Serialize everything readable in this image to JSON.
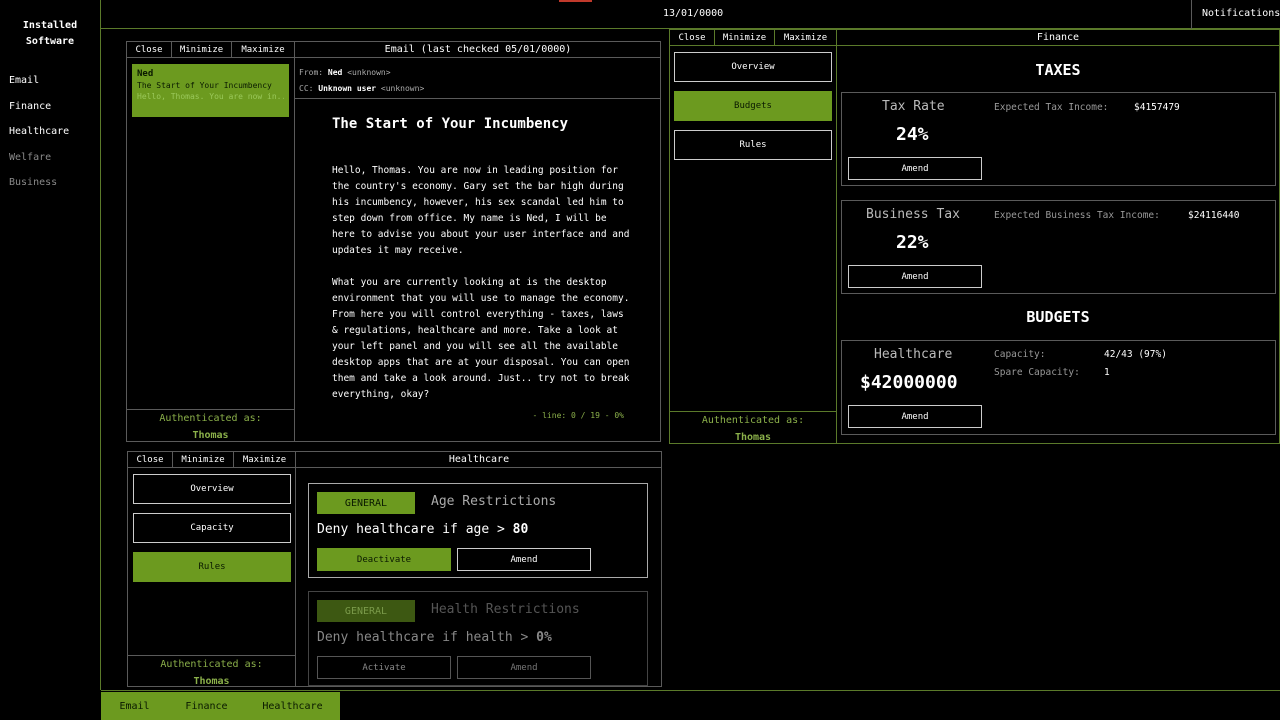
{
  "sidebar": {
    "title_line1": "Installed",
    "title_line2": "Software",
    "items": [
      {
        "label": "Email",
        "enabled": true
      },
      {
        "label": "Finance",
        "enabled": true
      },
      {
        "label": "Healthcare",
        "enabled": true
      },
      {
        "label": "Welfare",
        "enabled": false
      },
      {
        "label": "Business",
        "enabled": false
      }
    ]
  },
  "topbar": {
    "date": "13/01/0000",
    "notifications_label": "Notifications"
  },
  "window_buttons": {
    "close": "Close",
    "minimize": "Minimize",
    "maximize": "Maximize"
  },
  "email": {
    "title": "Email (last checked 05/01/0000)",
    "inbox": [
      {
        "from": "Ned",
        "subject": "The Start of Your Incumbency",
        "preview": "Hello, Thomas. You are now in..."
      }
    ],
    "header": {
      "from_label": "From:",
      "from_name": "Ned",
      "from_addr": "<unknown>",
      "cc_label": "CC:",
      "cc_name": "Unknown user",
      "cc_addr": "<unknown>"
    },
    "heading": "The Start of Your Incumbency",
    "body": "Hello, Thomas. You are now in leading position for\nthe country's economy. Gary set the bar high during\nhis incumbency, however, his sex scandal led him to\nstep down from office. My name is Ned, I will be\nhere to advise you about your user interface and and\nupdates it may receive.\n\nWhat you are currently looking at is the desktop\nenvironment that you will use to manage the economy.\nFrom here you will control everything - taxes, laws\n& regulations, healthcare and more. Take a look at\nyour left panel and you will see all the available\ndesktop apps that are at your disposal. You can open\nthem and take a look around. Just.. try not to break\neverything, okay?",
    "line_info": "- line: 0 / 19 - 0%",
    "auth_label": "Authenticated as:",
    "auth_user": "Thomas"
  },
  "finance": {
    "title": "Finance",
    "nav": [
      "Overview",
      "Budgets",
      "Rules"
    ],
    "active_nav": "Budgets",
    "auth_label": "Authenticated as:",
    "auth_user": "Thomas",
    "taxes_heading": "TAXES",
    "tax_rate": {
      "title": "Tax Rate",
      "value": "24%",
      "amend": "Amend",
      "expected_label": "Expected Tax Income:",
      "expected_value": "$4157479"
    },
    "business_tax": {
      "title": "Business Tax",
      "value": "22%",
      "amend": "Amend",
      "expected_label": "Expected Business Tax Income:",
      "expected_value": "$24116440"
    },
    "budgets_heading": "BUDGETS",
    "healthcare": {
      "title": "Healthcare",
      "value": "$42000000",
      "amend": "Amend",
      "capacity_label": "Capacity:",
      "capacity_value": "42/43 (97%)",
      "spare_label": "Spare Capacity:",
      "spare_value": "1"
    }
  },
  "healthcare": {
    "title": "Healthcare",
    "nav": [
      "Overview",
      "Capacity",
      "Rules"
    ],
    "active_nav": "Rules",
    "auth_label": "Authenticated as:",
    "auth_user": "Thomas",
    "rules": [
      {
        "tag": "GENERAL",
        "title": "Age Restrictions",
        "text_prefix": "Deny healthcare if age > ",
        "text_value": "80",
        "primary_action": "Deactivate",
        "secondary_action": "Amend",
        "active": true
      },
      {
        "tag": "GENERAL",
        "title": "Health Restrictions",
        "text_prefix": "Deny healthcare if health > ",
        "text_value": "0%",
        "primary_action": "Activate",
        "secondary_action": "Amend",
        "active": false
      }
    ]
  },
  "taskbar": {
    "items": [
      "Email",
      "Finance",
      "Healthcare"
    ]
  },
  "colors": {
    "accent_green": "#6c9a1f",
    "auth_green": "#8bb04a",
    "background": "#000000"
  }
}
